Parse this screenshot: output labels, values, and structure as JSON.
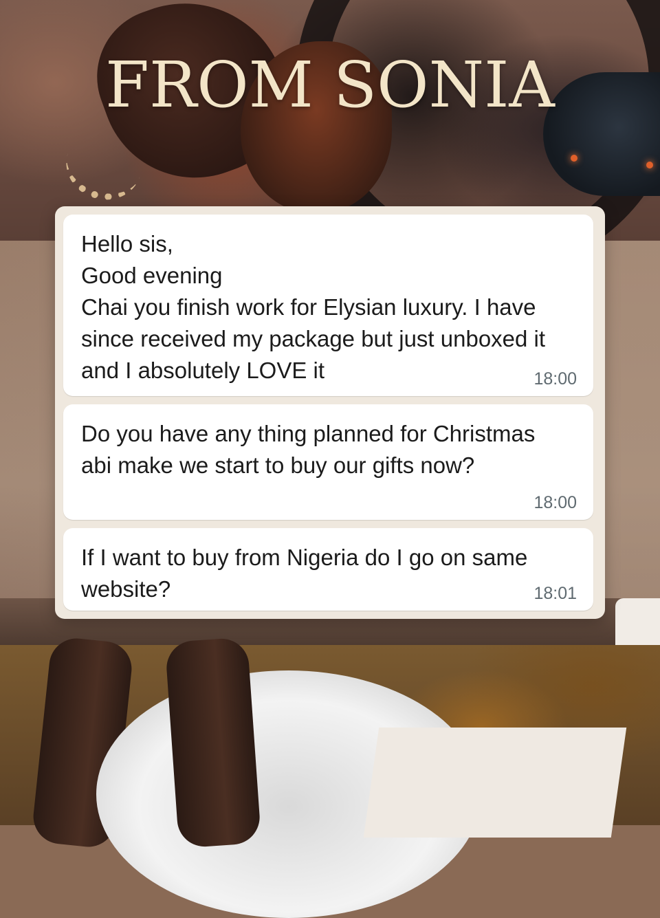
{
  "title": "FROM SONIA",
  "messages": [
    {
      "text": "Hello sis,\nGood evening\nChai you finish work for Elysian  luxury.  I have since received my package but just unboxed it and I absolutely LOVE it",
      "time": "18:00"
    },
    {
      "text": "Do you have any thing planned for Christmas abi make we start to buy our gifts now?",
      "time": "18:00"
    },
    {
      "text": "If I want to buy from Nigeria do I go on same website?",
      "time": "18:01"
    }
  ],
  "colors": {
    "title": "#f3e5c8",
    "bubble": "#ffffff",
    "chat_background": "#efe8de",
    "timestamp": "#5f6a70"
  }
}
